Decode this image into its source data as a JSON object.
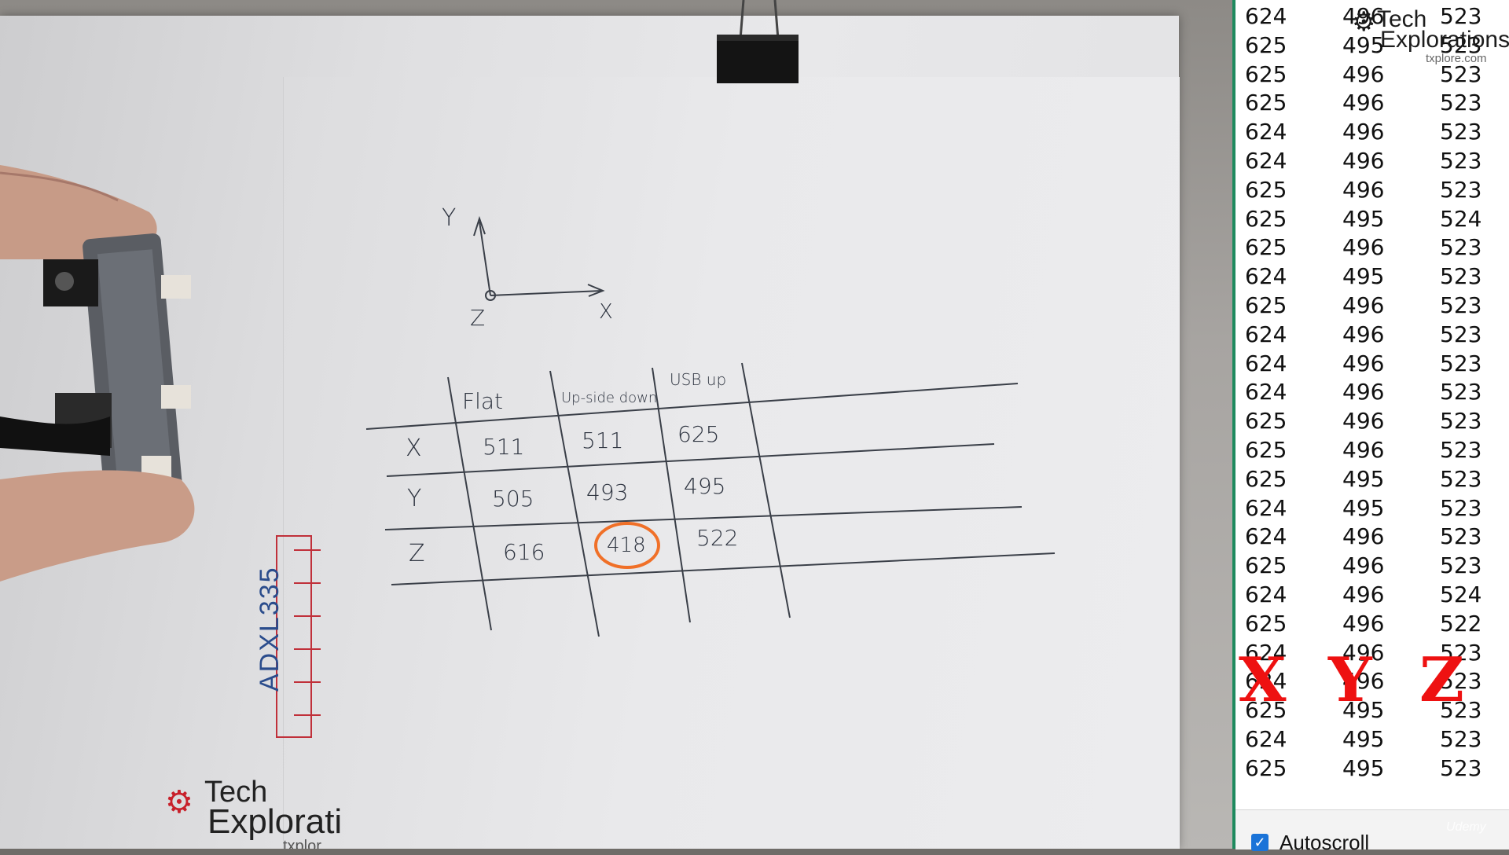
{
  "video": {
    "paper_table": {
      "headers": [
        "Flat",
        "Up-side down",
        "USB up"
      ],
      "rows": [
        {
          "axis": "X",
          "values": [
            "511",
            "511",
            "625"
          ]
        },
        {
          "axis": "Y",
          "values": [
            "505",
            "493",
            "495"
          ]
        },
        {
          "axis": "Z",
          "values": [
            "616",
            "418",
            "522"
          ]
        }
      ],
      "circled_value": "418",
      "circle_color": "#f07028"
    },
    "axes_sketch": {
      "y": "Y",
      "x": "X",
      "z": "Z"
    },
    "sensor_label": "ADXL335",
    "paper_logo": {
      "line1": "Tech",
      "line2": "Explorati",
      "line3": "txplor"
    }
  },
  "overlay_logo": {
    "line1": "Tech",
    "line2": "Explorations",
    "url": "txplore.com"
  },
  "serial_monitor": {
    "accent_color": "#1e8a5e",
    "rows": [
      [
        "624",
        "496",
        "523"
      ],
      [
        "625",
        "495",
        "523"
      ],
      [
        "625",
        "496",
        "523"
      ],
      [
        "625",
        "496",
        "523"
      ],
      [
        "624",
        "496",
        "523"
      ],
      [
        "624",
        "496",
        "523"
      ],
      [
        "625",
        "496",
        "523"
      ],
      [
        "625",
        "495",
        "524"
      ],
      [
        "625",
        "496",
        "523"
      ],
      [
        "624",
        "495",
        "523"
      ],
      [
        "625",
        "496",
        "523"
      ],
      [
        "624",
        "496",
        "523"
      ],
      [
        "624",
        "496",
        "523"
      ],
      [
        "624",
        "496",
        "523"
      ],
      [
        "625",
        "496",
        "523"
      ],
      [
        "625",
        "496",
        "523"
      ],
      [
        "625",
        "495",
        "523"
      ],
      [
        "624",
        "495",
        "523"
      ],
      [
        "624",
        "496",
        "523"
      ],
      [
        "625",
        "496",
        "523"
      ],
      [
        "624",
        "496",
        "524"
      ],
      [
        "625",
        "496",
        "522"
      ],
      [
        "624",
        "496",
        "523"
      ],
      [
        "624",
        "496",
        "523"
      ],
      [
        "625",
        "495",
        "523"
      ],
      [
        "624",
        "495",
        "523"
      ],
      [
        "625",
        "495",
        "523"
      ]
    ],
    "axis_overlay": {
      "x": "X",
      "y": "Y",
      "z": "Z",
      "color": "#ee1111"
    },
    "autoscroll_label": "Autoscroll",
    "autoscroll_checked": true
  },
  "watermark": "Udemy"
}
